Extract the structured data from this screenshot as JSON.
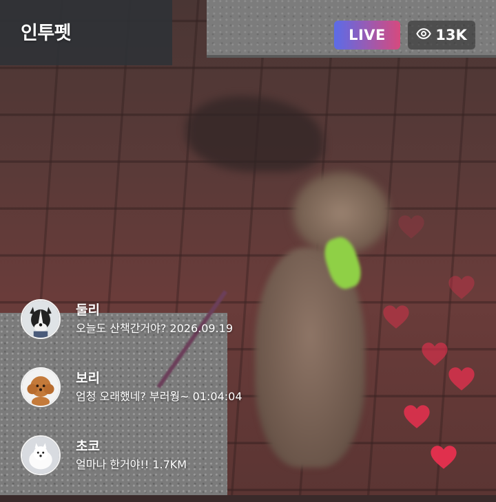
{
  "header": {
    "app_title": "인투펫",
    "live_label": "LIVE",
    "viewer_count": "13K",
    "viewer_icon": "eye-icon"
  },
  "comments": [
    {
      "name": "둘리",
      "message": "오늘도 산책간거야? 2026.09.19",
      "avatar": "dog-avatar-bordercollie"
    },
    {
      "name": "보리",
      "message": "엄청 오래했네? 부러웡~ 01:04:04",
      "avatar": "dog-avatar-poodle"
    },
    {
      "name": "초코",
      "message": "얼마나 한거야!! 1.7KM",
      "avatar": "dog-avatar-spitz"
    }
  ],
  "colors": {
    "live_gradient_start": "#5b6ce8",
    "live_gradient_end": "#d64a7e",
    "heart": "#e8304f"
  }
}
